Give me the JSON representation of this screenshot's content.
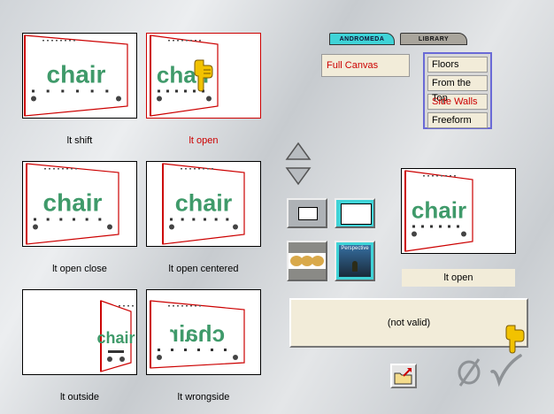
{
  "tabs": [
    {
      "label": "ANDROMEDA",
      "active": true
    },
    {
      "label": "LIBRARY",
      "active": false
    }
  ],
  "canvas_mode": "Full Canvas",
  "projection_menu": {
    "items": [
      "Floors",
      "From the Top",
      "Side Walls",
      "Freeform"
    ],
    "selected": "Side Walls"
  },
  "thumbnails": [
    {
      "caption": "lt shift",
      "variant": "shift",
      "selected": false
    },
    {
      "caption": "lt open",
      "variant": "open",
      "selected": true
    },
    {
      "caption": "lt open close",
      "variant": "open_close",
      "selected": false
    },
    {
      "caption": "lt open centered",
      "variant": "open_centered",
      "selected": false
    },
    {
      "caption": "lt outside",
      "variant": "outside",
      "selected": false
    },
    {
      "caption": "lt wrongside",
      "variant": "wrongside",
      "selected": false
    }
  ],
  "thumbnail_word": "chair",
  "tools": [
    {
      "name": "small-frame",
      "active": false
    },
    {
      "name": "large-frame",
      "active": true
    },
    {
      "name": "texture",
      "active": false
    },
    {
      "name": "perspective",
      "active": true,
      "label": "Perspective"
    }
  ],
  "preview": {
    "caption": "lt open"
  },
  "status_text": "(not valid)",
  "colors": {
    "accent": "#3fd3d7",
    "selected_text": "#cc0000",
    "field_bg": "#f2ecd9",
    "menu_border": "#6a6ad6",
    "chair_green": "#3f9a6a"
  },
  "icons": {
    "up": "triangle-up",
    "down": "triangle-down",
    "folder": "folder-export",
    "cancel": "empty-set",
    "ok": "checkmark",
    "hand": "pointing-hand"
  }
}
